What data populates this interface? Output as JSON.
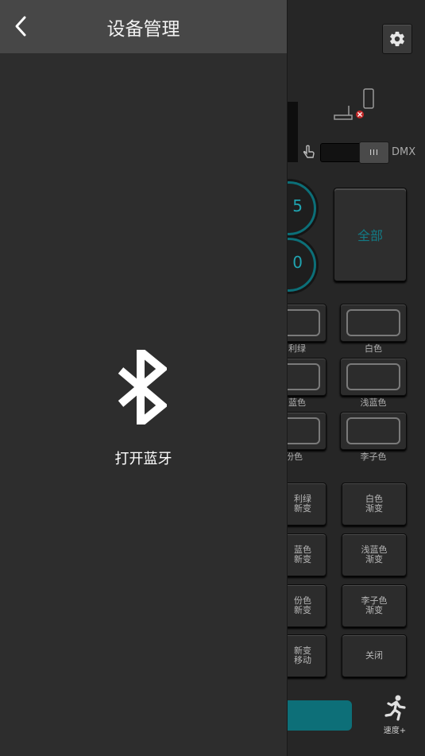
{
  "background_panel": {
    "settings_icon": "gear-icon",
    "connection_icon": "device-disconnected-icon",
    "touch_icon": "hand-pointer-icon",
    "toggle_knob_label": "III",
    "dmx_label": "DMX",
    "knobs": [
      "5",
      "0"
    ],
    "all_button_label": "全部",
    "color_buttons": [
      {
        "label": "利绿"
      },
      {
        "label": "白色"
      },
      {
        "label": "蓝色"
      },
      {
        "label": "浅蓝色"
      },
      {
        "label": "份色"
      },
      {
        "label": "李子色"
      }
    ],
    "gradient_buttons": [
      {
        "line1": "利绿",
        "line2": "新变"
      },
      {
        "line1": "白色",
        "line2": "渐变"
      },
      {
        "line1": "蓝色",
        "line2": "新变"
      },
      {
        "line1": "浅蓝色",
        "line2": "渐变"
      },
      {
        "line1": "份色",
        "line2": "新变"
      },
      {
        "line1": "李子色",
        "line2": "渐变"
      },
      {
        "line1": "新变",
        "line2": "移动"
      },
      {
        "line1": "关闭",
        "line2": ""
      }
    ],
    "speed_label": "速度+",
    "speed_icon": "running-person-icon",
    "colors": {
      "accent": "#0d6f78",
      "accent_text": "#20a3b0"
    }
  },
  "drawer": {
    "title": "设备管理",
    "back_icon": "chevron-left-icon",
    "bluetooth_icon": "bluetooth-icon",
    "bluetooth_label": "打开蓝牙"
  }
}
